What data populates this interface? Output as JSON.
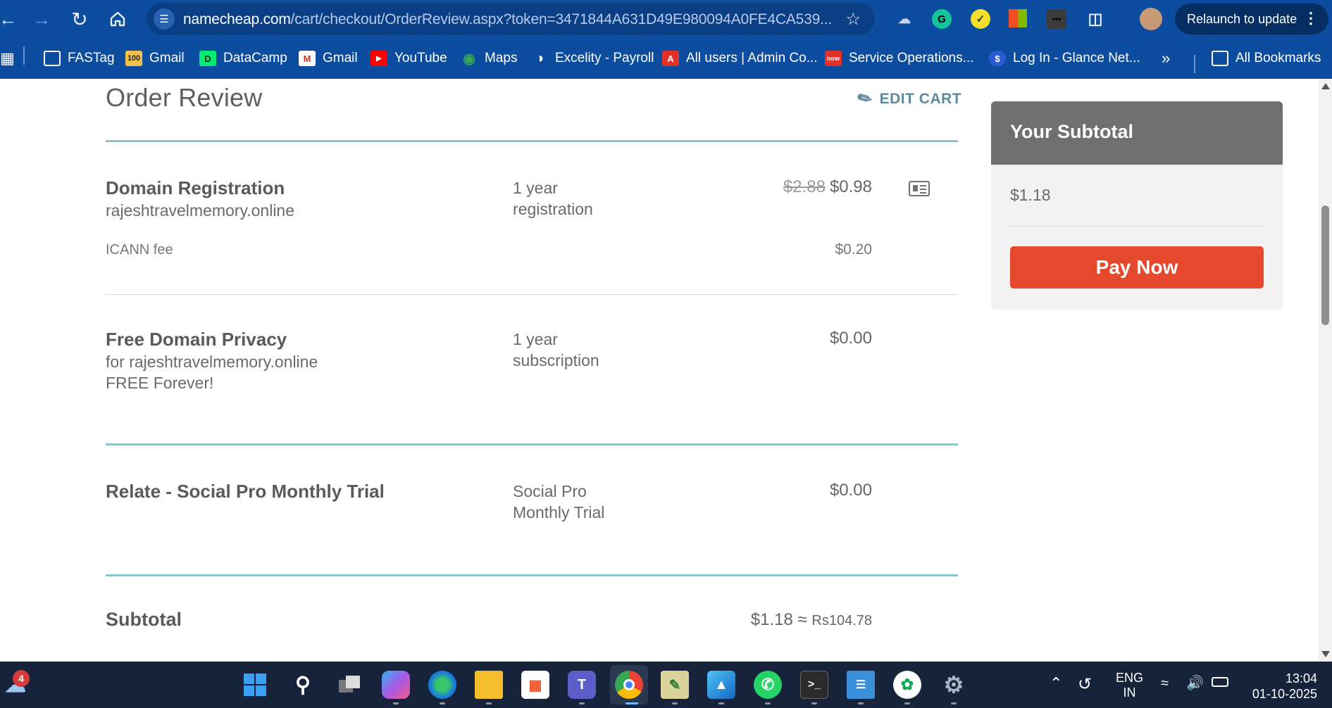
{
  "browser": {
    "url_host": "namecheap.com",
    "url_path": "/cart/checkout/OrderReview.aspx?token=3471844A631D49E980094A0FE4CA539...",
    "relaunch_label": "Relaunch to update"
  },
  "bookmarks": [
    {
      "label": "FASTag",
      "icon": "folder-icon"
    },
    {
      "label": "Gmail",
      "icon": "gmail-icon"
    },
    {
      "label": "DataCamp",
      "icon": "datacamp-icon"
    },
    {
      "label": "Gmail",
      "icon": "gmail-icon"
    },
    {
      "label": "YouTube",
      "icon": "youtube-icon"
    },
    {
      "label": "Maps",
      "icon": "maps-icon"
    },
    {
      "label": "Excelity - Payroll",
      "icon": "globe-icon"
    },
    {
      "label": "All users | Admin Co...",
      "icon": "admin-icon"
    },
    {
      "label": "Service Operations...",
      "icon": "servicenow-icon"
    },
    {
      "label": "Log In - Glance Net...",
      "icon": "glance-icon"
    },
    {
      "label": "All Bookmarks",
      "icon": "folder-icon"
    }
  ],
  "page": {
    "title": "Order Review",
    "edit_cart": "EDIT CART",
    "items": [
      {
        "name": "Domain Registration",
        "detail": "rajeshtravelmemory.online",
        "term_line1": "1 year",
        "term_line2": "registration",
        "old_price": "$2.88",
        "price": "$0.98",
        "fee_label": "ICANN fee",
        "fee_price": "$0.20"
      },
      {
        "name": "Free Domain Privacy",
        "detail": "for rajeshtravelmemory.online",
        "detail2": "FREE Forever!",
        "term_line1": "1 year",
        "term_line2": "subscription",
        "price": "$0.00"
      },
      {
        "name": "Relate - Social Pro Monthly Trial",
        "term_line1": "Social Pro",
        "term_line2": "Monthly Trial",
        "price": "$0.00"
      }
    ],
    "subtotal_label": "Subtotal",
    "subtotal_usd": "$1.18 ≈",
    "subtotal_inr": "Rs104.78"
  },
  "sidebar": {
    "heading": "Your Subtotal",
    "amount": "$1.18",
    "pay_label": "Pay Now"
  },
  "taskbar": {
    "weather_badge": "4",
    "lang_line1": "ENG",
    "lang_line2": "IN",
    "time": "13:04",
    "date": "01-10-2025"
  },
  "colors": {
    "chrome_blue": "#0d4da0",
    "accent_teal": "#8dc4c5",
    "pay_button": "#e5482d",
    "subtotal_header": "#6f6f6f"
  }
}
